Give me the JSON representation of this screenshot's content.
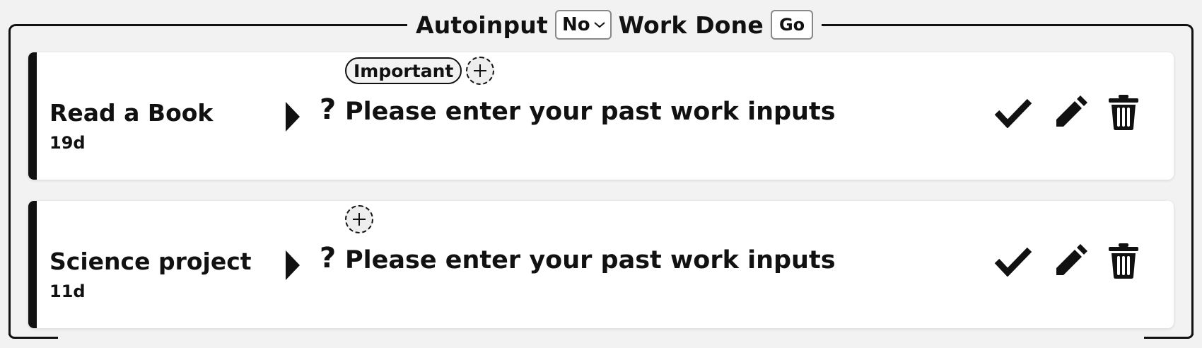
{
  "header": {
    "autoinput_label": "Autoinput",
    "autoinput_value": "No",
    "work_done_label": "Work Done",
    "go_label": "Go"
  },
  "tasks": [
    {
      "name": "Read a Book",
      "age": "19d",
      "tags": [
        "Important"
      ],
      "work_prompt": "Please enter your past work inputs",
      "question_glyph": "?"
    },
    {
      "name": "Science project",
      "age": "11d",
      "tags": [],
      "work_prompt": "Please enter your past work inputs",
      "question_glyph": "?"
    }
  ],
  "icons": {
    "expand": "caret-right-icon",
    "add_tag": "plus-icon",
    "complete": "check-icon",
    "edit": "pencil-icon",
    "delete": "trash-icon"
  },
  "colors": {
    "background": "#f2f2f2",
    "card": "#ffffff",
    "accent": "#111111"
  }
}
